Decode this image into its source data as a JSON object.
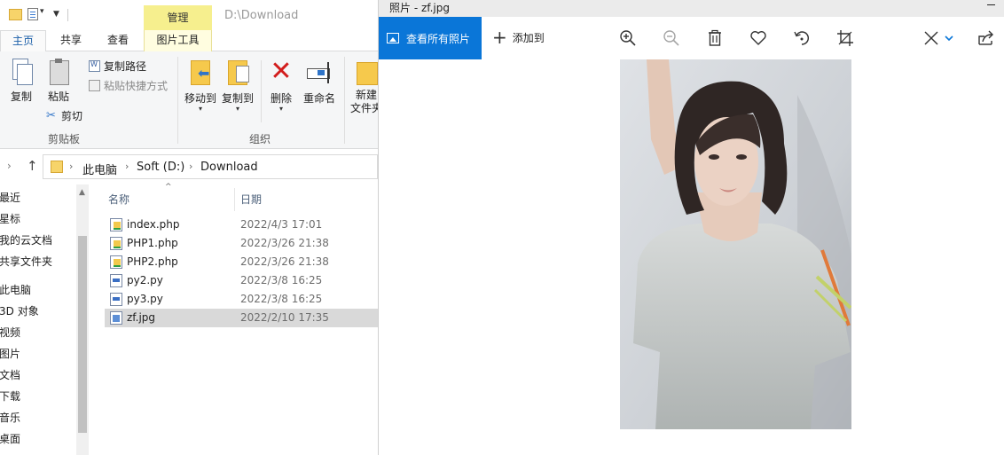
{
  "explorer": {
    "context_tab": "管理",
    "window_path": "D:\\Download",
    "ribbon_tabs": {
      "home": "主页",
      "share": "共享",
      "view": "查看",
      "picture_tools": "图片工具"
    },
    "clipboard": {
      "copy": "复制",
      "paste": "粘贴",
      "copy_path": "复制路径",
      "paste_shortcut": "粘贴快捷方式",
      "cut": "剪切",
      "group": "剪贴板"
    },
    "organize": {
      "move_to": "移动到",
      "copy_to": "复制到",
      "delete": "删除",
      "rename": "重命名",
      "group": "组织"
    },
    "new": {
      "new_folder_line1": "新建",
      "new_folder_line2": "文件夹"
    },
    "breadcrumb": [
      "此电脑",
      "Soft (D:)",
      "Download"
    ],
    "nav_items": [
      "最近",
      "星标",
      "我的云文档",
      "共享文件夹",
      "此电脑",
      "3D 对象",
      "视频",
      "图片",
      "文档",
      "下载",
      "音乐",
      "桌面"
    ],
    "columns": {
      "name": "名称",
      "date": "日期"
    },
    "files": [
      {
        "name": "index.php",
        "date": "2022/4/3 17:01",
        "type": "php"
      },
      {
        "name": "PHP1.php",
        "date": "2022/3/26 21:38",
        "type": "php"
      },
      {
        "name": "PHP2.php",
        "date": "2022/3/26 21:38",
        "type": "php"
      },
      {
        "name": "py2.py",
        "date": "2022/3/8 16:25",
        "type": "py"
      },
      {
        "name": "py3.py",
        "date": "2022/3/8 16:25",
        "type": "py"
      },
      {
        "name": "zf.jpg",
        "date": "2022/2/10 17:35",
        "type": "jpg",
        "selected": true
      }
    ]
  },
  "photos": {
    "title": "照片 - zf.jpg",
    "view_all": "查看所有照片",
    "add_to": "添加到",
    "icons": [
      "zoom-in-icon",
      "zoom-out-icon",
      "delete-icon",
      "favorite-icon",
      "rotate-icon",
      "crop-icon",
      "edit-icon",
      "share-icon"
    ],
    "accent": "#0a76d8"
  }
}
